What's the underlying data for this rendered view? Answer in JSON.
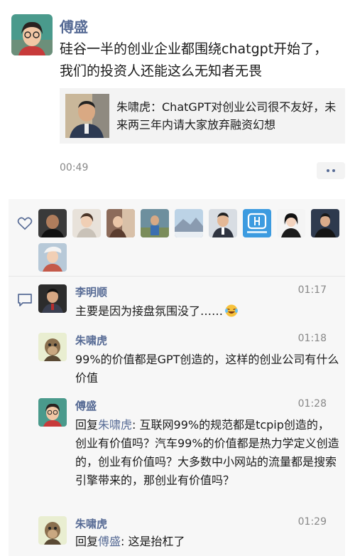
{
  "post": {
    "author": "傅盛",
    "text": "硅谷一半的创业企业都围绕chatgpt开始了，我们的投资人还能这么无知者无畏",
    "shared_card": {
      "text": "朱啸虎：ChatGPT对创业公司很不友好，未来两三年内请大家放弃融资幻想"
    },
    "time": "00:49",
    "more_icon": "ellipsis-icon"
  },
  "likes": {
    "icon": "heart-icon",
    "count": 10
  },
  "comments": {
    "icon": "comment-icon",
    "items": [
      {
        "author": "李明顺",
        "time": "01:17",
        "text": "主要是因为接盘氛围没了……",
        "emoji": "laughing-crying-emoji"
      },
      {
        "author": "朱啸虎",
        "time": "01:18",
        "text": "99%的价值都是GPT创造的，这样的创业公司有什么价值"
      },
      {
        "author": "傅盛",
        "time": "01:28",
        "reply_prefix": "回复",
        "reply_to": "朱啸虎",
        "text": ": 互联网99%的规范都是tcpip创造的，创业有价值吗？汽车99%的价值都是热力学定义创造的，创业有价值吗？大多数中小网站的流量都是搜索引擎带来的，那创业有价值吗？"
      },
      {
        "author": "朱啸虎",
        "time": "01:29",
        "reply_prefix": "回复",
        "reply_to": "傅盛",
        "text": ": 这是抬杠了"
      }
    ]
  }
}
